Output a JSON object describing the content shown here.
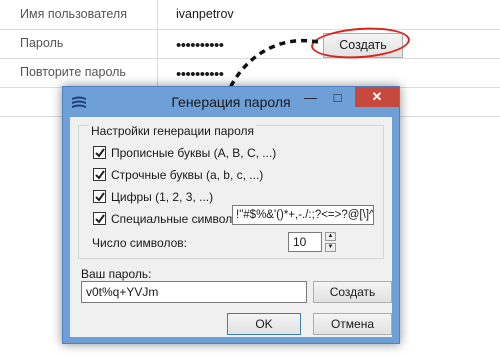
{
  "background_form": {
    "rows": [
      {
        "label": "Имя пользователя",
        "value": "ivanpetrov"
      },
      {
        "label": "Пароль",
        "value": "••••••••••"
      },
      {
        "label": "Повторите пароль",
        "value": "••••••••••"
      }
    ],
    "create_button": "Создать"
  },
  "dialog": {
    "title": "Генерация пароля",
    "minimize": "—",
    "maximize": "□",
    "close": "✕",
    "group_title": "Настройки генерации пароля",
    "options": [
      {
        "label": "Прописные буквы (A, B, C, ...)",
        "checked": true
      },
      {
        "label": "Строчные буквы (a, b, c, ...)",
        "checked": true
      },
      {
        "label": "Цифры (1, 2, 3, ...)",
        "checked": true
      },
      {
        "label": "Специальные символы",
        "checked": true
      }
    ],
    "special_chars_value": "!\"#$%&'()*+,-./:;?<=>?@[\\]^_",
    "count_label": "Число символов:",
    "count_value": "10",
    "password_label": "Ваш пароль:",
    "password_value": "v0t%q+YVJm",
    "create_button": "Создать",
    "ok_button": "OK",
    "cancel_button": "Отмена"
  },
  "colors": {
    "titlebar": "#6e9fd6",
    "close_button": "#c7483c",
    "highlight_ellipse": "#d9231d"
  }
}
